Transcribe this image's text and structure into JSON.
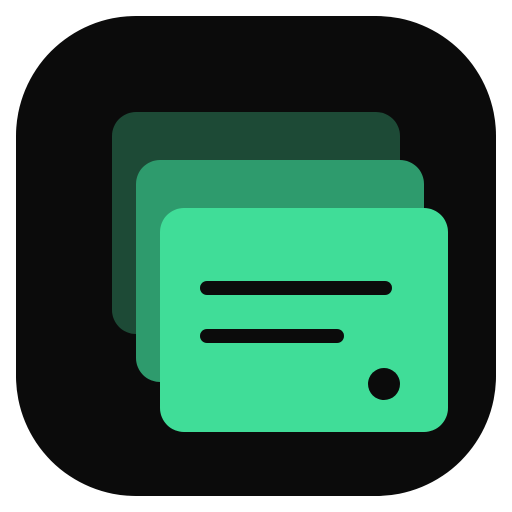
{
  "app_icon": {
    "icon": "stacked-cards-icon",
    "colors": {
      "background": "#0b0b0b",
      "card_back": "#1d4a36",
      "card_middle": "#2e9b6d",
      "card_front": "#40dd98",
      "detail": "#0b0b0b"
    }
  }
}
